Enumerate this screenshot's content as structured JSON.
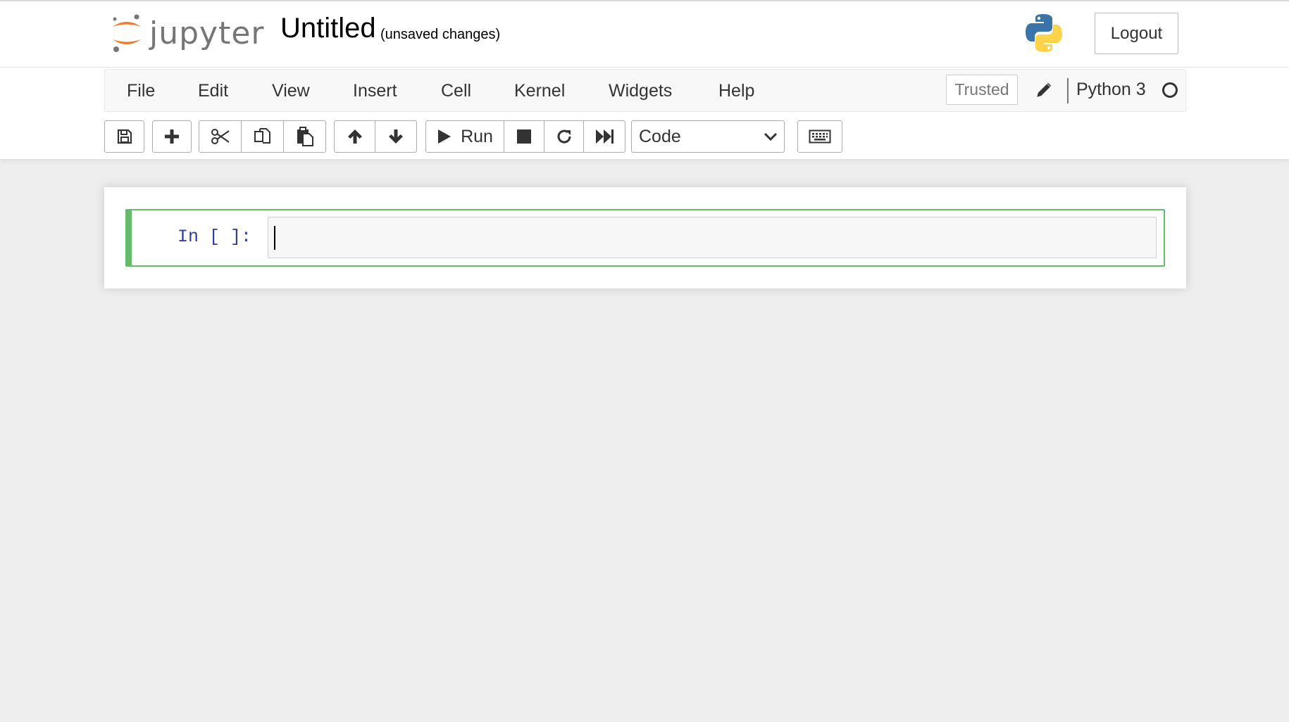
{
  "header": {
    "logo_text": "jupyter",
    "notebook_name": "Untitled",
    "save_status": "(unsaved changes)",
    "logout_label": "Logout"
  },
  "menubar": {
    "items": [
      "File",
      "Edit",
      "View",
      "Insert",
      "Cell",
      "Kernel",
      "Widgets",
      "Help"
    ],
    "trusted_label": "Trusted",
    "kernel_name": "Python 3",
    "kernel_status": "idle"
  },
  "toolbar": {
    "buttons": [
      "save-icon",
      "plus-icon",
      "scissors-icon",
      "copy-icon",
      "paste-icon",
      "arrow-up-icon",
      "arrow-down-icon",
      "play-icon",
      "stop-icon",
      "restart-icon",
      "fast-forward-icon",
      "keyboard-icon"
    ],
    "run_label": "Run",
    "cell_type": "Code"
  },
  "cell": {
    "prompt": "In [ ]:",
    "code": ""
  },
  "colors": {
    "accent_edit_mode": "#66bb6a",
    "prompt_color": "#303f9f",
    "jupyter_orange": "#f37726"
  }
}
